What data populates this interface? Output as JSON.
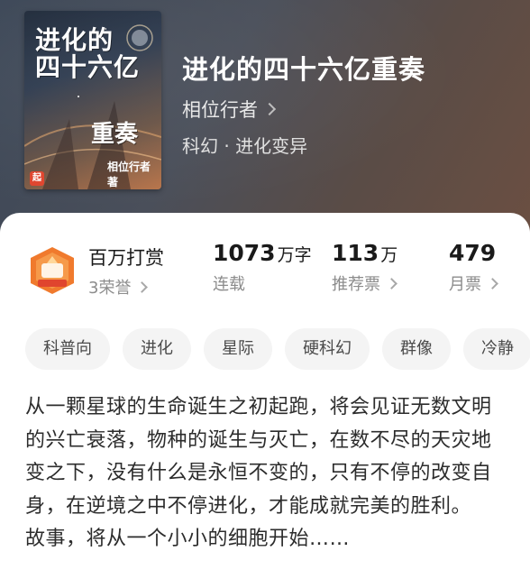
{
  "header": {
    "cover": {
      "title_line1": "进化的\n四十六亿",
      "title_line2": "重奏",
      "author": "相位行者 著",
      "logo_text": "起"
    },
    "book_title": "进化的四十六亿重奏",
    "author": "相位行者",
    "genre": "科幻 · 进化变异"
  },
  "stats": {
    "honor_title": "百万打赏",
    "honor_count": "3荣誉",
    "word_count": {
      "num": "1073",
      "unit": "万字",
      "label": "连载"
    },
    "recommend": {
      "num": "113",
      "unit": "万",
      "label": "推荐票"
    },
    "monthly": {
      "num": "479",
      "unit": "",
      "label": "月票"
    }
  },
  "tags": [
    "科普向",
    "进化",
    "星际",
    "硬科幻",
    "群像",
    "冷静"
  ],
  "description": {
    "para1": "从一颗星球的生命诞生之初起跑，将会见证无数文明的兴亡衰落，物种的诞生与灭亡，在数不尽的天灾地变之下，没有什么是永恒不变的，只有不停的改变自身，在逆境之中不停进化，才能成就完美的胜利。",
    "para2": "故事，将从一个小小的细胞开始……"
  },
  "colors": {
    "header_bg": "#4a4f5a",
    "badge_orange": "#f07a2d",
    "tag_bg": "#f4f4f4",
    "text_primary": "#1a1a1a",
    "text_secondary": "#8c8c8c"
  }
}
